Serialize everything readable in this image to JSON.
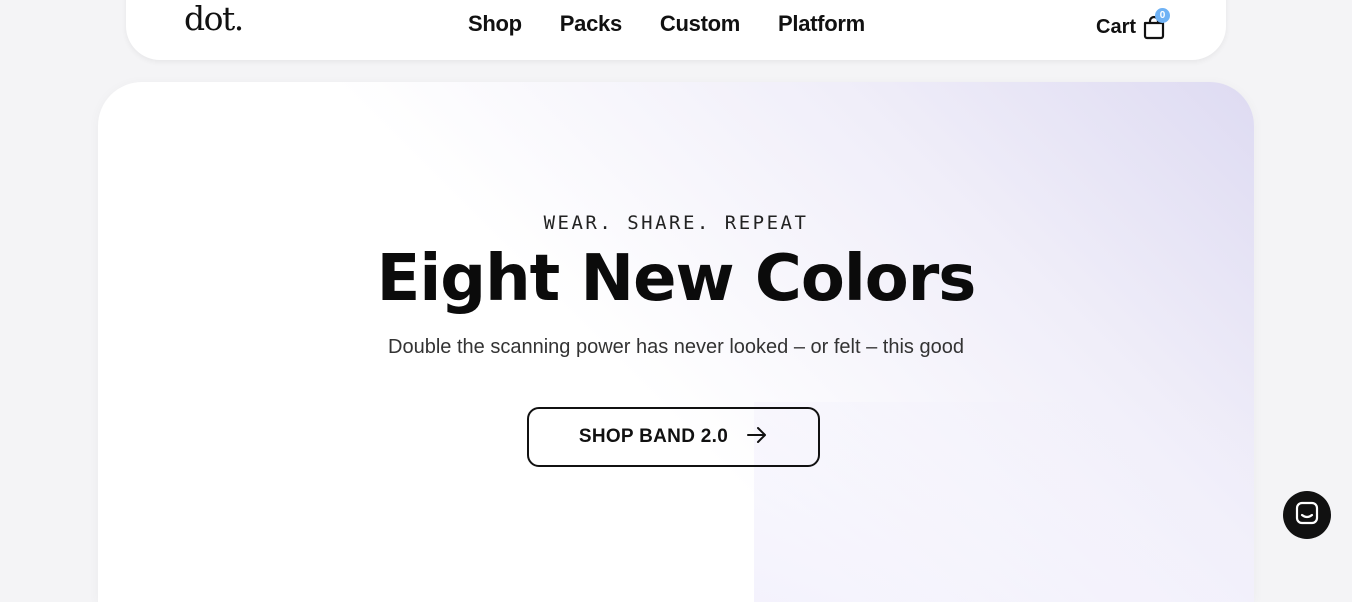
{
  "header": {
    "logo": "dot.",
    "nav": [
      {
        "label": "Shop"
      },
      {
        "label": "Packs"
      },
      {
        "label": "Custom"
      },
      {
        "label": "Platform"
      }
    ],
    "cart": {
      "label": "Cart",
      "count": "0"
    }
  },
  "hero": {
    "eyebrow": "WEAR. SHARE. REPEAT",
    "title": "Eight New Colors",
    "subtitle": "Double the scanning power has never looked – or felt – this good",
    "cta_label": "SHOP BAND 2.0",
    "cta_icon": "arrow-right-icon"
  },
  "chat": {
    "icon": "chat-icon"
  }
}
